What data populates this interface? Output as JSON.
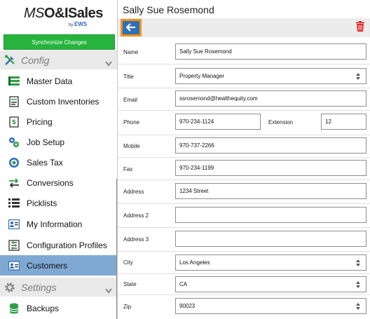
{
  "app": {
    "logo_prefix": "MS",
    "logo_brand": "O&ISales",
    "logo_by": "by",
    "logo_ews": "EWS"
  },
  "sidebar": {
    "sync_label": "Synchronize Changes",
    "config_header": "Config",
    "settings_header": "Settings",
    "items": [
      {
        "label": "Master Data",
        "icon": "master-data-icon"
      },
      {
        "label": "Custom Inventories",
        "icon": "custom-inventories-icon"
      },
      {
        "label": "Pricing",
        "icon": "pricing-icon"
      },
      {
        "label": "Job Setup",
        "icon": "job-setup-icon"
      },
      {
        "label": "Sales Tax",
        "icon": "sales-tax-icon"
      },
      {
        "label": "Conversions",
        "icon": "conversions-icon"
      },
      {
        "label": "Picklists",
        "icon": "picklists-icon"
      },
      {
        "label": "My Information",
        "icon": "my-information-icon"
      },
      {
        "label": "Configuration Profiles",
        "icon": "configuration-profiles-icon"
      },
      {
        "label": "Customers",
        "icon": "customers-icon",
        "active": true
      }
    ],
    "settings_items": [
      {
        "label": "Backups",
        "icon": "backups-icon"
      }
    ]
  },
  "main": {
    "title": "Sally Sue Rosemond",
    "fields": {
      "name": {
        "label": "Name",
        "value": "Sally Sue Rosemond"
      },
      "title": {
        "label": "Title",
        "value": "Property Manager"
      },
      "email": {
        "label": "Email",
        "value": "ssrosemond@healthequity.com"
      },
      "phone": {
        "label": "Phone",
        "value": "970-234-1124"
      },
      "extension": {
        "label": "Extension",
        "value": "12"
      },
      "mobile": {
        "label": "Mobile",
        "value": "970-737-2266"
      },
      "fax": {
        "label": "Fax",
        "value": "970-234-1199"
      },
      "address": {
        "label": "Address",
        "value": "1234 Street"
      },
      "address2": {
        "label": "Address 2",
        "value": ""
      },
      "address3": {
        "label": "Address 3",
        "value": ""
      },
      "city": {
        "label": "City",
        "value": "Los Angeles"
      },
      "state": {
        "label": "State",
        "value": "CA"
      },
      "zip": {
        "label": "Zip",
        "value": "90023"
      }
    }
  },
  "colors": {
    "sync_green": "#27b43d",
    "active_item": "#7fa9d3",
    "back_blue": "#2f6fb8",
    "highlight_orange": "#f39314",
    "trash_red": "#e02a2a"
  }
}
